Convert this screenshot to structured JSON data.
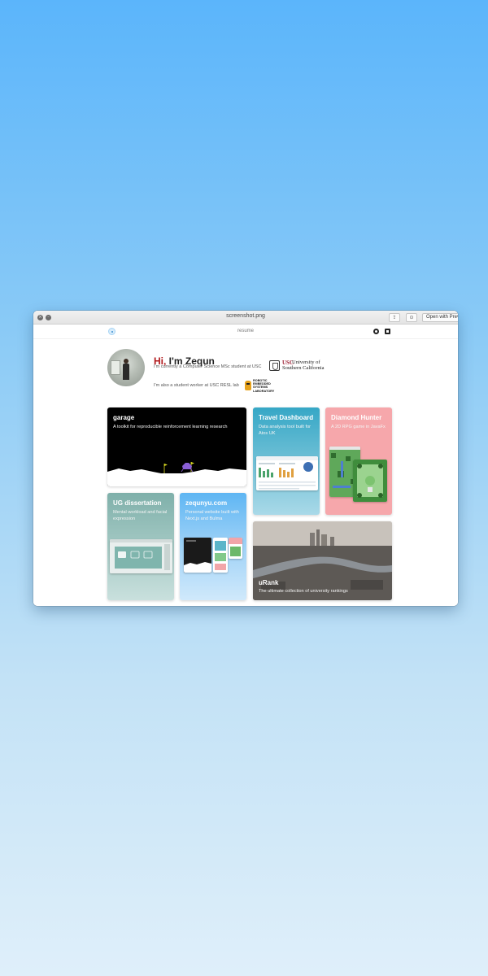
{
  "window": {
    "title": "screenshot.png",
    "toolbar": {
      "open_with_preview": "Open with Preview"
    }
  },
  "nav": {
    "center_label": "resume"
  },
  "hero": {
    "greeting_accent": "Hi,",
    "greeting_rest": " I'm Zequn",
    "line1": "I'm currently a Computer Science MSc student at USC",
    "line2": "I'm also a student worker at USC RESL lab",
    "usc_logo": {
      "abbr": "USC",
      "line1": "University of",
      "line2": "Southern California"
    },
    "resl_logo": {
      "text": "ROBOTIC\nEMBEDDED\nSYSTEMS\nLABORATORY"
    }
  },
  "projects": [
    {
      "title": "garage",
      "subtitle": "A toolkit for reproducible reinforcement learning research"
    },
    {
      "title": "Travel Dashboard",
      "subtitle": "Data analysis tool built for Atos UK"
    },
    {
      "title": "Diamond Hunter",
      "subtitle": "A 2D RPG game in JavaFx"
    },
    {
      "title": "UG dissertation",
      "subtitle": "Mental workload and facial expression"
    },
    {
      "title": "zequnyu.com",
      "subtitle": "Personal website built with Next.js and Bulma"
    },
    {
      "title": "uRank",
      "subtitle": "The ultimate collection of university rankings"
    }
  ],
  "colors": {
    "accent_red": "#b0181b",
    "background_top": "#5bb5fb",
    "background_bottom": "#dfeffa"
  },
  "icons": [
    "close-icon",
    "minimize-icon",
    "share-icon",
    "markup-icon",
    "github-icon",
    "linkedin-icon"
  ]
}
